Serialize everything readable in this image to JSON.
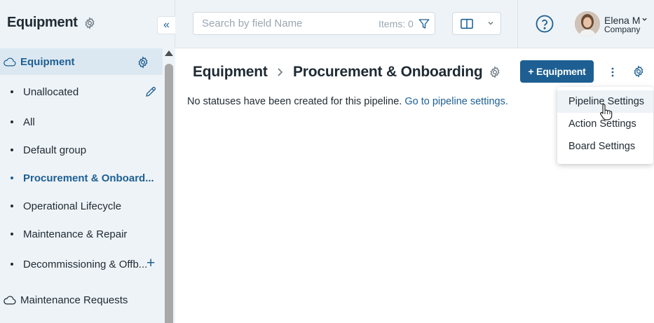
{
  "sidebar": {
    "title": "Equipment",
    "collapse_glyph": "«",
    "sections": [
      {
        "label": "Equipment",
        "icon": "cloud-icon",
        "active": true
      },
      {
        "label": "Maintenance Requests",
        "icon": "cloud-icon",
        "active": false
      }
    ],
    "items": [
      {
        "label": "Unallocated"
      },
      {
        "label": "All"
      },
      {
        "label": "Default group"
      },
      {
        "label": "Procurement & Onboard..."
      },
      {
        "label": "Operational Lifecycle"
      },
      {
        "label": "Maintenance & Repair"
      },
      {
        "label": "Decommissioning & Offb..."
      }
    ],
    "add_glyph": "+"
  },
  "topbar": {
    "search_placeholder": "Search by field Name",
    "items_count": "Items: 0",
    "user": {
      "name": "Elena M",
      "company": "Company"
    }
  },
  "main": {
    "breadcrumb_root": "Equipment",
    "breadcrumb_current": "Procurement & Onboarding",
    "add_button_label": "+ Equipment",
    "empty_message": "No statuses have been created for this pipeline.",
    "empty_link": "Go to pipeline settings."
  },
  "settings_menu": {
    "items": [
      "Pipeline Settings",
      "Action Settings",
      "Board Settings"
    ]
  },
  "colors": {
    "accent": "#1d5f92",
    "sidebar_bg": "#eef3f7",
    "active_bg": "#dce8f1"
  }
}
